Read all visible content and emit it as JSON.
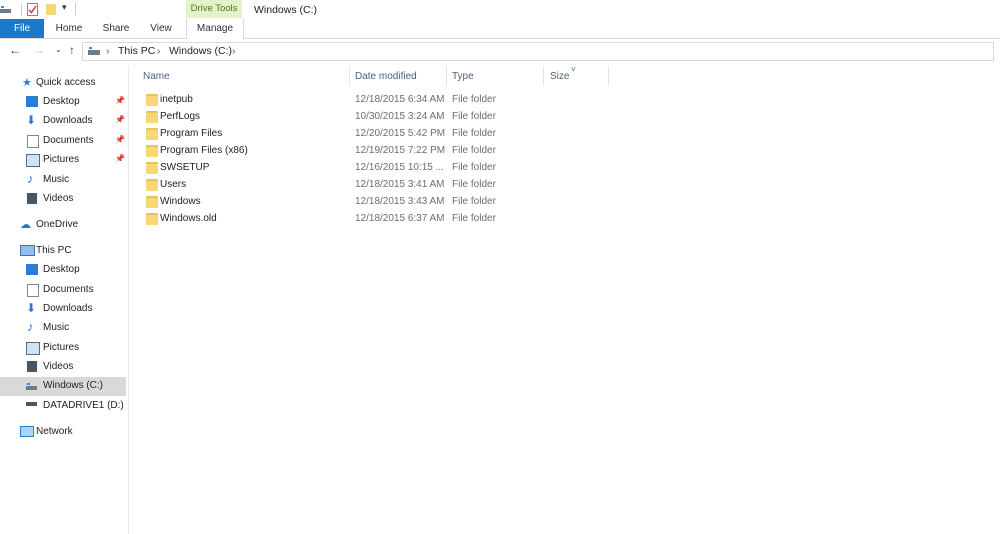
{
  "titlebar": {
    "drive_tools": "Drive Tools",
    "window_title": "Windows (C:)"
  },
  "ribbon": {
    "tabs": [
      "File",
      "Home",
      "Share",
      "View",
      "Manage"
    ]
  },
  "address": {
    "crumbs": [
      "This PC",
      "Windows (C:)"
    ]
  },
  "columns": {
    "name": "Name",
    "date": "Date modified",
    "type": "Type",
    "size": "Size"
  },
  "nav": {
    "quick_access": "Quick access",
    "qa_items": [
      "Desktop",
      "Downloads",
      "Documents",
      "Pictures",
      "Music",
      "Videos"
    ],
    "onedrive": "OneDrive",
    "this_pc": "This PC",
    "pc_items": [
      "Desktop",
      "Documents",
      "Downloads",
      "Music",
      "Pictures",
      "Videos",
      "Windows (C:)",
      "DATADRIVE1 (D:)"
    ],
    "network": "Network"
  },
  "files": [
    {
      "name": "inetpub",
      "date": "12/18/2015 6:34 AM",
      "type": "File folder"
    },
    {
      "name": "PerfLogs",
      "date": "10/30/2015 3:24 AM",
      "type": "File folder"
    },
    {
      "name": "Program Files",
      "date": "12/20/2015 5:42 PM",
      "type": "File folder"
    },
    {
      "name": "Program Files (x86)",
      "date": "12/19/2015 7:22 PM",
      "type": "File folder"
    },
    {
      "name": "SWSETUP",
      "date": "12/16/2015 10:15 ...",
      "type": "File folder"
    },
    {
      "name": "Users",
      "date": "12/18/2015 3:41 AM",
      "type": "File folder"
    },
    {
      "name": "Windows",
      "date": "12/18/2015 3:43 AM",
      "type": "File folder"
    },
    {
      "name": "Windows.old",
      "date": "12/18/2015 6:37 AM",
      "type": "File folder"
    }
  ]
}
